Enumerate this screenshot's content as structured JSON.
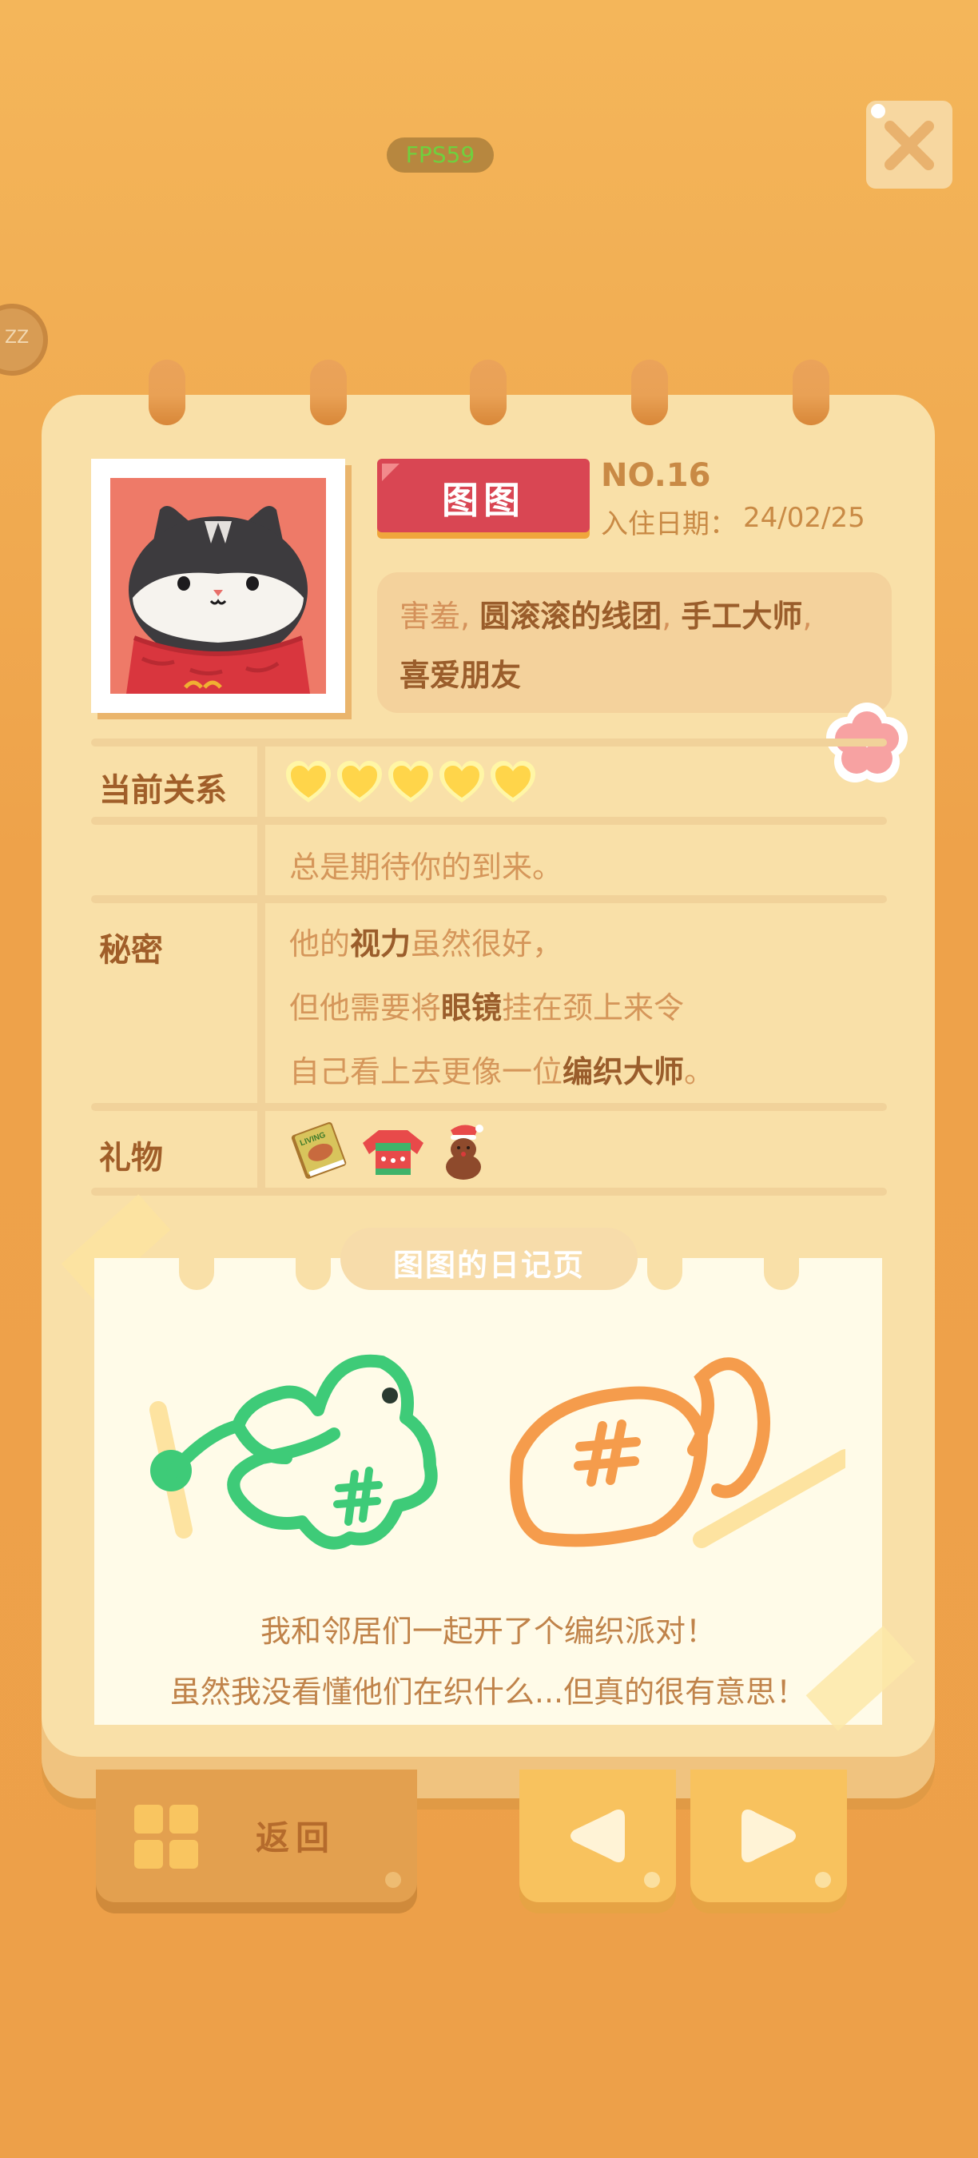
{
  "hud": {
    "fps": "FPS59"
  },
  "character": {
    "name": "图图",
    "number": "NO.16",
    "date_label": "入住日期：",
    "date_value": "24/02/25",
    "tags_line1": [
      {
        "text": "害羞",
        "style": "light"
      },
      {
        "text": ", ",
        "style": "light"
      },
      {
        "text": "圆滚滚的线团",
        "style": "dark"
      },
      {
        "text": ", ",
        "style": "light"
      },
      {
        "text": "手工大师",
        "style": "dark"
      },
      {
        "text": ",",
        "style": "light"
      }
    ],
    "tags_line2": [
      {
        "text": "喜爱朋友",
        "style": "dark"
      }
    ]
  },
  "relationship": {
    "label": "当前关系",
    "hearts": 5,
    "heart_color": "#ffd54a",
    "note": "总是期待你的到来。"
  },
  "secret": {
    "label": "秘密",
    "line1": [
      {
        "text": "他的",
        "style": "l"
      },
      {
        "text": "视力",
        "style": "d"
      },
      {
        "text": "虽然很好，",
        "style": "l"
      }
    ],
    "line2": [
      {
        "text": "但他需要将",
        "style": "l"
      },
      {
        "text": "眼镜",
        "style": "d"
      },
      {
        "text": "挂在颈上来令",
        "style": "l"
      }
    ],
    "line3": [
      {
        "text": "自己看上去更像一位",
        "style": "l"
      },
      {
        "text": "编织大师",
        "style": "d"
      },
      {
        "text": "。",
        "style": "l"
      }
    ]
  },
  "gifts": {
    "label": "礼物",
    "items": [
      "book-icon",
      "sweater-icon",
      "reindeer-icon"
    ],
    "book_text": "LIVING"
  },
  "diary": {
    "title": "图图的日记页",
    "line1": "我和邻居们一起开了个编织派对！",
    "line2": "虽然我没看懂他们在织什么...但真的很有意思！"
  },
  "nav": {
    "back_label": "返回"
  },
  "colors": {
    "background": "#eea24a",
    "paper": "#f9e0a8",
    "name_tag": "#d94653",
    "green_yarn": "#3ecb78",
    "orange_yarn": "#f59c4c"
  }
}
